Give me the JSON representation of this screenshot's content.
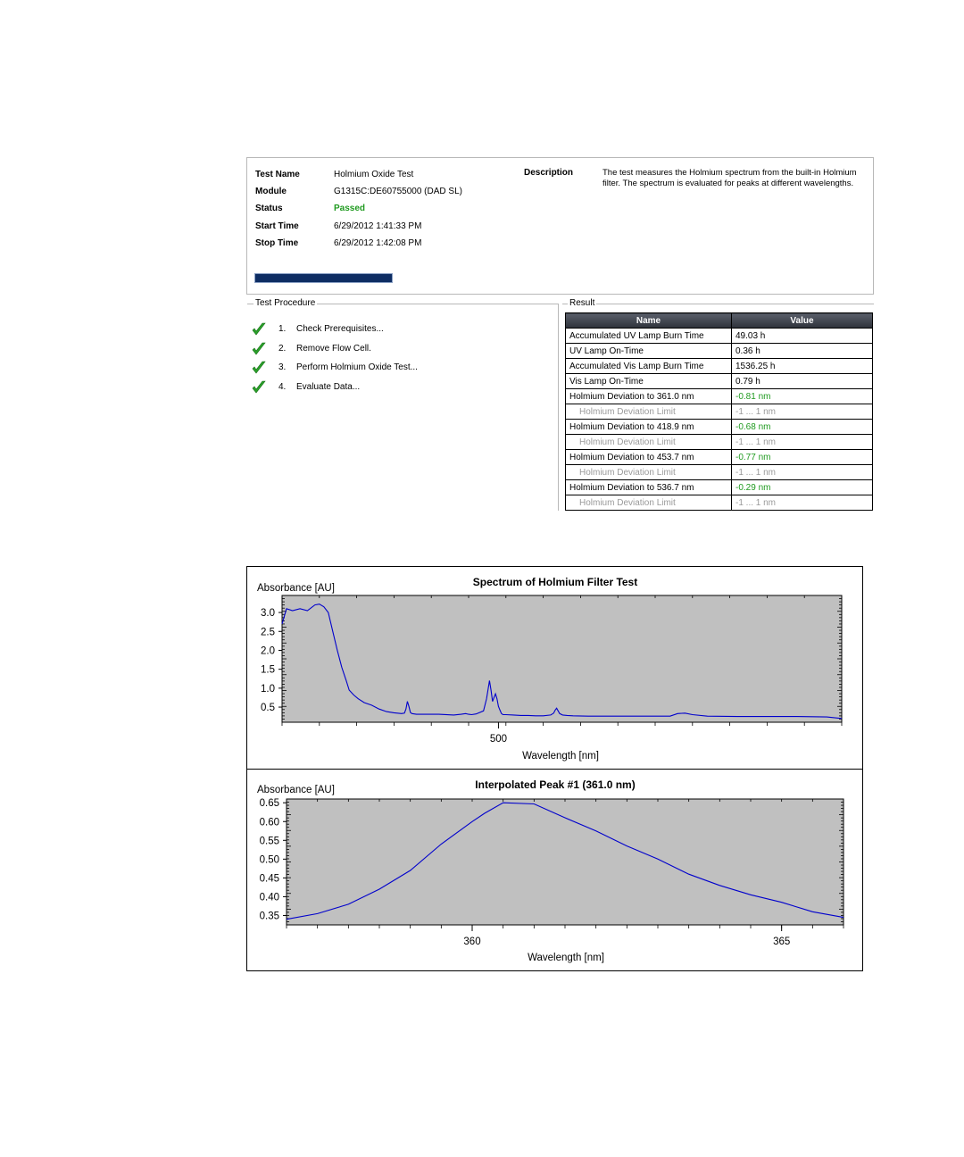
{
  "header": {
    "test_name_label": "Test Name",
    "test_name_value": "Holmium Oxide Test",
    "module_label": "Module",
    "module_value": "G1315C:DE60755000 (DAD SL)",
    "status_label": "Status",
    "status_value": "Passed",
    "start_label": "Start Time",
    "start_value": "6/29/2012 1:41:33 PM",
    "stop_label": "Stop Time",
    "stop_value": "6/29/2012 1:42:08 PM",
    "description_label": "Description",
    "description_value": "The test measures the Holmium spectrum from the built-in Holmium filter. The spectrum is evaluated for peaks at different wavelengths.",
    "progress": 1.0
  },
  "procedure": {
    "title": "Test Procedure",
    "steps": [
      {
        "num": "1.",
        "label": "Check Prerequisites..."
      },
      {
        "num": "2.",
        "label": "Remove Flow Cell."
      },
      {
        "num": "3.",
        "label": "Perform Holmium Oxide Test..."
      },
      {
        "num": "4.",
        "label": "Evaluate Data..."
      }
    ]
  },
  "result": {
    "title": "Result",
    "col_name": "Name",
    "col_value": "Value",
    "rows": [
      {
        "name": "Accumulated UV Lamp Burn Time",
        "value": "49.03 h"
      },
      {
        "name": "UV Lamp On-Time",
        "value": "0.36 h"
      },
      {
        "name": "Accumulated Vis Lamp Burn Time",
        "value": "1536.25 h"
      },
      {
        "name": "Vis Lamp On-Time",
        "value": "0.79 h"
      },
      {
        "name": "Holmium Deviation to 361.0 nm",
        "value": "-0.81 nm"
      },
      {
        "name": "Holmium Deviation Limit",
        "value": "-1 ... 1 nm"
      },
      {
        "name": "Holmium Deviation to 418.9 nm",
        "value": "-0.68 nm"
      },
      {
        "name": "Holmium Deviation Limit",
        "value": "-1 ... 1 nm"
      },
      {
        "name": "Holmium Deviation to 453.7 nm",
        "value": "-0.77 nm"
      },
      {
        "name": "Holmium Deviation Limit",
        "value": "-1 ... 1 nm"
      },
      {
        "name": "Holmium Deviation to 536.7 nm",
        "value": "-0.29 nm"
      },
      {
        "name": "Holmium Deviation Limit",
        "value": "-1 ... 1 nm"
      }
    ]
  },
  "colors": {
    "passed": "#1f9a1f",
    "plot_background": "#c0c0c0",
    "trace": "#0000cc",
    "progress": "#0e2d63"
  },
  "chart_data": [
    {
      "type": "line",
      "title": "Spectrum of Holmium Filter Test",
      "xlabel": "Wavelength [nm]",
      "ylabel": "Absorbance [AU]",
      "xlim": [
        355,
        730
      ],
      "ylim": [
        0.1,
        3.45
      ],
      "x_ticks": [
        "500"
      ],
      "y_ticks": [
        "3.0",
        "2.5",
        "2.0",
        "1.5",
        "1.0",
        "0.5"
      ],
      "series": [
        {
          "x": [
            355,
            358,
            362,
            367,
            372,
            377,
            380,
            383,
            386,
            389,
            392,
            395,
            398,
            400,
            403,
            406,
            410,
            415,
            420,
            425,
            430,
            435,
            437,
            438,
            439,
            440,
            441,
            442,
            445,
            450,
            460,
            470,
            475,
            478,
            480,
            482,
            485,
            490,
            492,
            494,
            495,
            496,
            497,
            498,
            499,
            500,
            501,
            502,
            503,
            505,
            510,
            515,
            520,
            525,
            530,
            535,
            537,
            538,
            539,
            540,
            541,
            543,
            546,
            550,
            560,
            570,
            580,
            590,
            600,
            615,
            620,
            625,
            630,
            640,
            660,
            680,
            700,
            720,
            730
          ],
          "y": [
            2.7,
            3.1,
            3.05,
            3.1,
            3.05,
            3.2,
            3.22,
            3.15,
            3.0,
            2.5,
            2.0,
            1.55,
            1.2,
            0.95,
            0.82,
            0.72,
            0.62,
            0.55,
            0.45,
            0.38,
            0.35,
            0.33,
            0.34,
            0.45,
            0.65,
            0.52,
            0.36,
            0.33,
            0.31,
            0.31,
            0.31,
            0.29,
            0.31,
            0.33,
            0.31,
            0.3,
            0.32,
            0.4,
            0.72,
            1.2,
            0.95,
            0.65,
            0.75,
            0.85,
            0.72,
            0.52,
            0.42,
            0.33,
            0.3,
            0.3,
            0.29,
            0.28,
            0.28,
            0.27,
            0.27,
            0.29,
            0.34,
            0.42,
            0.47,
            0.4,
            0.33,
            0.29,
            0.28,
            0.27,
            0.26,
            0.26,
            0.26,
            0.26,
            0.26,
            0.26,
            0.33,
            0.34,
            0.3,
            0.26,
            0.25,
            0.25,
            0.25,
            0.24,
            0.2
          ]
        }
      ]
    },
    {
      "type": "line",
      "title": "Interpolated Peak #1 (361.0 nm)",
      "xlabel": "Wavelength [nm]",
      "ylabel": "Absorbance [AU]",
      "xlim": [
        357,
        366
      ],
      "ylim": [
        0.325,
        0.66
      ],
      "x_ticks": [
        "360",
        "365"
      ],
      "y_ticks": [
        "0.65",
        "0.60",
        "0.55",
        "0.50",
        "0.45",
        "0.40",
        "0.35"
      ],
      "series": [
        {
          "x": [
            357.0,
            357.5,
            358.0,
            358.5,
            359.0,
            359.5,
            360.0,
            360.2,
            360.5,
            361.0,
            361.5,
            362.0,
            362.5,
            363.0,
            363.5,
            364.0,
            364.5,
            365.0,
            365.5,
            366.0
          ],
          "y": [
            0.34,
            0.355,
            0.38,
            0.42,
            0.47,
            0.54,
            0.6,
            0.622,
            0.65,
            0.647,
            0.61,
            0.575,
            0.535,
            0.5,
            0.46,
            0.43,
            0.405,
            0.385,
            0.36,
            0.345
          ]
        }
      ]
    }
  ]
}
